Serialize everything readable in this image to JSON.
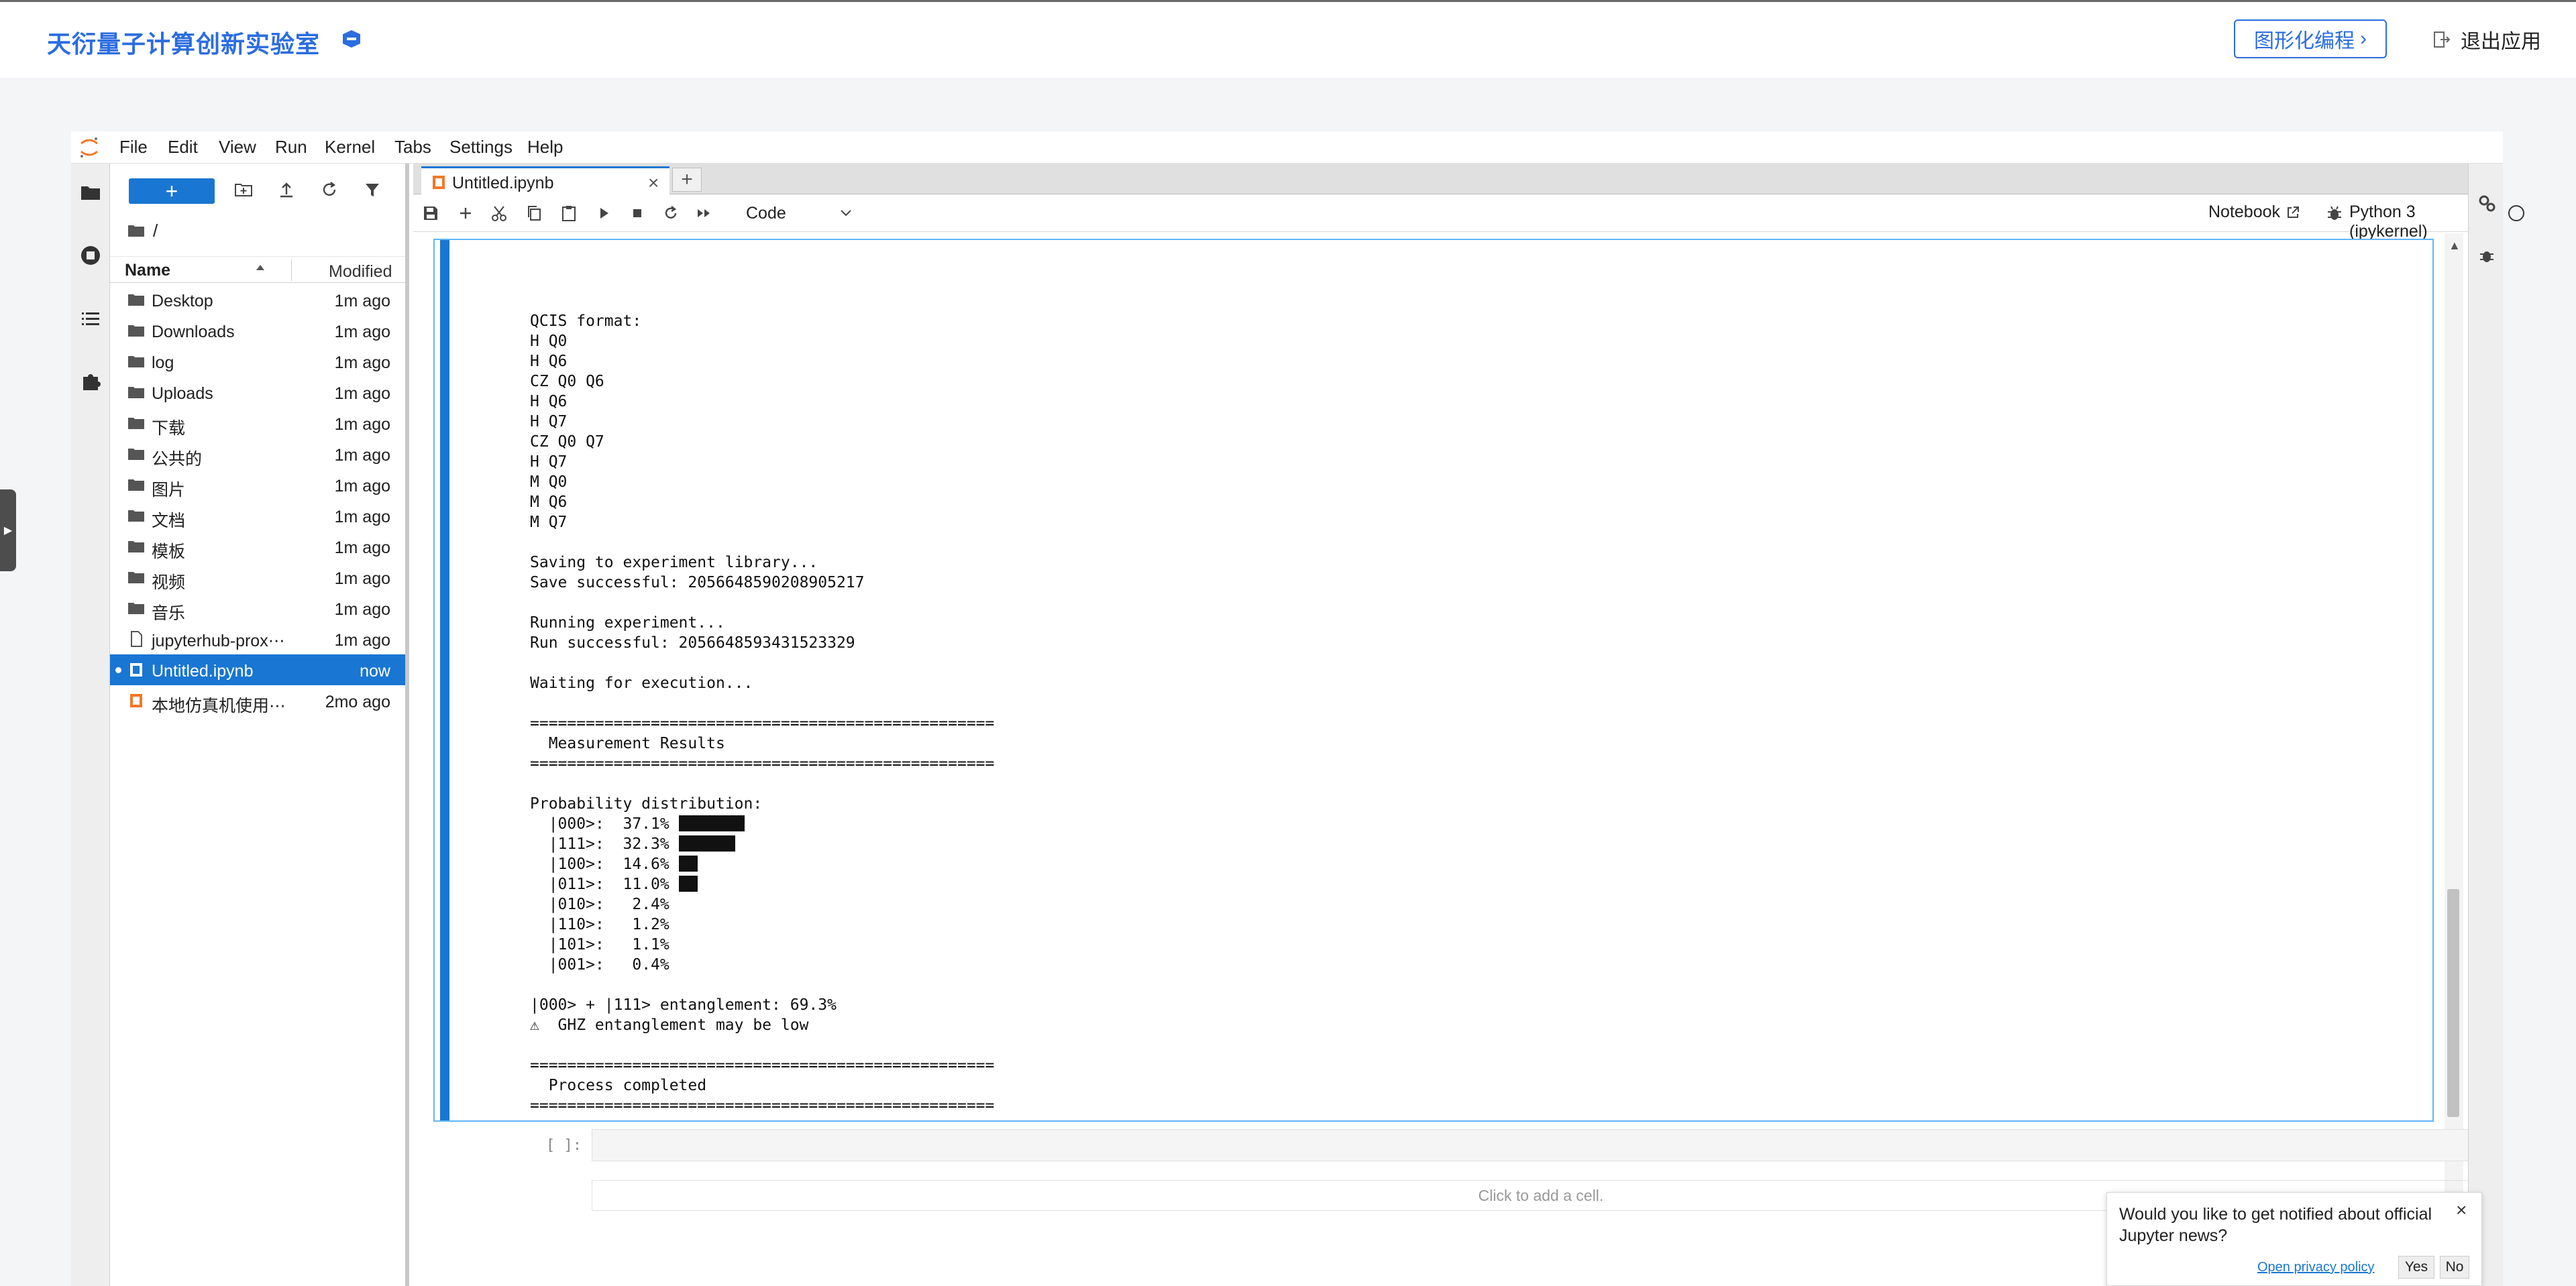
{
  "app_header": {
    "brand": "天衍量子计算创新实验室",
    "visual_programming_label": "图形化编程",
    "exit_label": "退出应用"
  },
  "menubar": [
    "File",
    "Edit",
    "View",
    "Run",
    "Kernel",
    "Tabs",
    "Settings",
    "Help"
  ],
  "filebrowser": {
    "new_label": "+",
    "breadcrumb": "/",
    "col_name": "Name",
    "col_modified": "Modified",
    "items": [
      {
        "name": "Desktop",
        "modified": "1m ago",
        "icon": "folder-icon"
      },
      {
        "name": "Downloads",
        "modified": "1m ago",
        "icon": "folder-icon"
      },
      {
        "name": "log",
        "modified": "1m ago",
        "icon": "folder-icon"
      },
      {
        "name": "Uploads",
        "modified": "1m ago",
        "icon": "folder-icon"
      },
      {
        "name": "下载",
        "modified": "1m ago",
        "icon": "folder-icon"
      },
      {
        "name": "公共的",
        "modified": "1m ago",
        "icon": "folder-icon"
      },
      {
        "name": "图片",
        "modified": "1m ago",
        "icon": "folder-icon"
      },
      {
        "name": "文档",
        "modified": "1m ago",
        "icon": "folder-icon"
      },
      {
        "name": "模板",
        "modified": "1m ago",
        "icon": "folder-icon"
      },
      {
        "name": "视频",
        "modified": "1m ago",
        "icon": "folder-icon"
      },
      {
        "name": "音乐",
        "modified": "1m ago",
        "icon": "folder-icon"
      },
      {
        "name": "jupyterhub-prox⋯",
        "modified": "1m ago",
        "icon": "file-icon"
      },
      {
        "name": "Untitled.ipynb",
        "modified": "now",
        "icon": "notebook-icon",
        "selected": true
      },
      {
        "name": "本地仿真机使用⋯",
        "modified": "2mo ago",
        "icon": "notebook-icon"
      }
    ]
  },
  "tab": {
    "title": "Untitled.ipynb",
    "close": "×",
    "add": "+"
  },
  "toolbar": {
    "cell_type": "Code",
    "notebook_label": "Notebook",
    "kernel_name": "Python 3 (ipykernel)"
  },
  "output": {
    "lines": [
      "QCIS format:",
      "H Q0",
      "H Q6",
      "CZ Q0 Q6",
      "H Q6",
      "H Q7",
      "CZ Q0 Q7",
      "H Q7",
      "M Q0",
      "M Q6",
      "M Q7",
      "",
      "Saving to experiment library...",
      "Save successful: 2056648590208905217",
      "",
      "Running experiment...",
      "Run successful: 2056648593431523329",
      "",
      "Waiting for execution...",
      "",
      "==================================================",
      "  Measurement Results",
      "==================================================",
      "",
      "Probability distribution:"
    ],
    "distribution": [
      {
        "state": "|000>",
        "pct": "37.1%",
        "value": 37.1
      },
      {
        "state": "|111>",
        "pct": "32.3%",
        "value": 32.3
      },
      {
        "state": "|100>",
        "pct": "14.6%",
        "value": 14.6
      },
      {
        "state": "|011>",
        "pct": "11.0%",
        "value": 11.0
      },
      {
        "state": "|010>",
        "pct": "2.4%",
        "value": 2.4
      },
      {
        "state": "|110>",
        "pct": "1.2%",
        "value": 1.2
      },
      {
        "state": "|101>",
        "pct": "1.1%",
        "value": 1.1
      },
      {
        "state": "|001>",
        "pct": "0.4%",
        "value": 0.4
      }
    ],
    "tail_lines": [
      "",
      "|000> + |111> entanglement: 69.3%",
      "⚠  GHZ entanglement may be low",
      "",
      "==================================================",
      "  Process completed",
      "=================================================="
    ]
  },
  "empty_cell": {
    "prompt": "[ ]:",
    "add_cell_hint": "Click to add a cell."
  },
  "toast": {
    "message": "Would you like to get notified about official Jupyter news?",
    "privacy": "Open privacy policy",
    "yes": "Yes",
    "no": "No",
    "close": "×"
  },
  "colors": {
    "accent": "#1976d2",
    "brand": "#2b6de0"
  }
}
